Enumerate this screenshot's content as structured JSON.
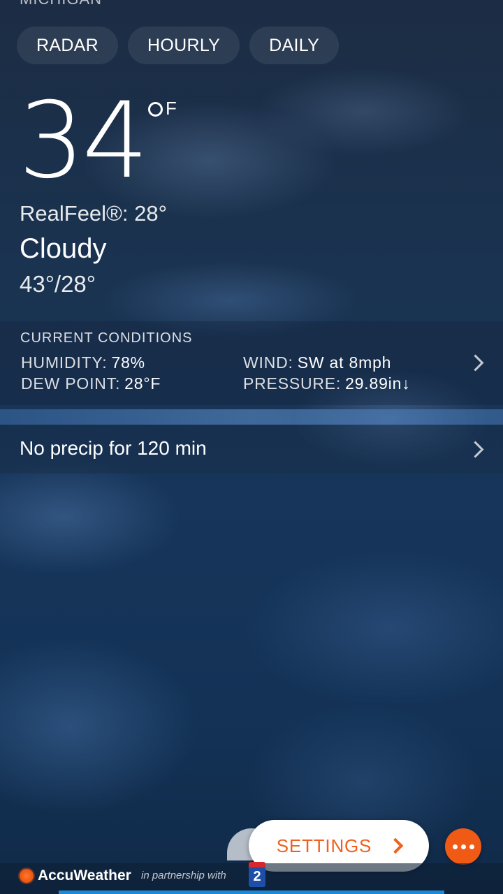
{
  "location": {
    "name_cut": "MICHIGAN"
  },
  "tabs": [
    {
      "label": "RADAR"
    },
    {
      "label": "HOURLY"
    },
    {
      "label": "DAILY"
    }
  ],
  "current": {
    "temperature": "34",
    "unit": "F",
    "realfeel": "RealFeel®: 28°",
    "condition": "Cloudy",
    "hi_lo": "43°/28°"
  },
  "conditions": {
    "title": "CURRENT CONDITIONS",
    "humidity_label": "HUMIDITY:",
    "humidity_value": "78%",
    "dew_point_label": "DEW POINT:",
    "dew_point_value": "28°F",
    "wind_label": "WIND:",
    "wind_value": "SW at 8mph",
    "pressure_label": "PRESSURE:",
    "pressure_value": "29.89in↓"
  },
  "precip": {
    "text": "No precip for 120 min"
  },
  "actions": {
    "settings_label": "SETTINGS"
  },
  "footer": {
    "brand": "AccuWeather",
    "partner_text": "in partnership with",
    "partner_logo_text": "2"
  },
  "colors": {
    "accent": "#f05a14",
    "settings_text": "#f0601e",
    "bottom_bar": "#1a8ad8"
  },
  "icons": [
    "chevron-right-icon",
    "more-dots-icon",
    "accuweather-sun-icon",
    "tv-station-logo"
  ]
}
